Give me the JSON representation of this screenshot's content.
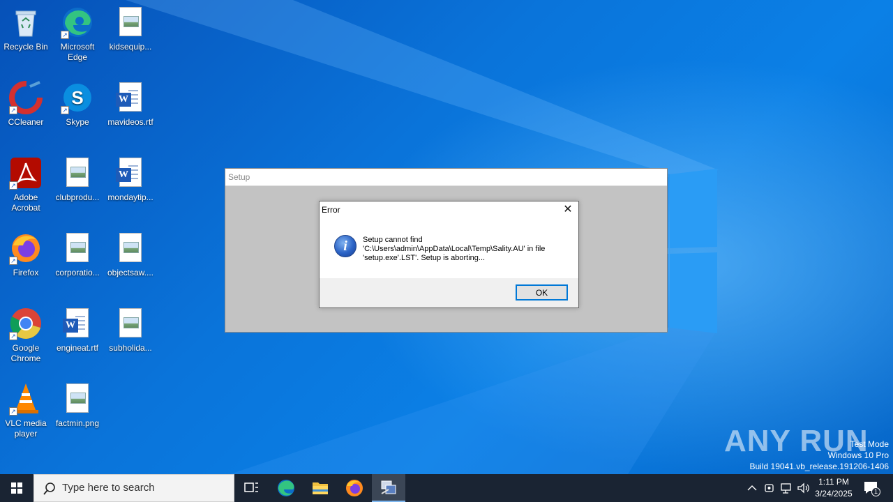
{
  "desktop": {
    "icons": [
      {
        "id": "recycle-bin",
        "label": "Recycle Bin"
      },
      {
        "id": "microsoft-edge",
        "label": "Microsoft Edge"
      },
      {
        "id": "kidsequip",
        "label": "kidsequip..."
      },
      {
        "id": "ccleaner",
        "label": "CCleaner"
      },
      {
        "id": "skype",
        "label": "Skype"
      },
      {
        "id": "mavideos",
        "label": "mavideos.rtf"
      },
      {
        "id": "adobe-acrobat",
        "label": "Adobe Acrobat"
      },
      {
        "id": "clubprodu",
        "label": "clubprodu..."
      },
      {
        "id": "mondaytip",
        "label": "mondaytip..."
      },
      {
        "id": "firefox",
        "label": "Firefox"
      },
      {
        "id": "corporatio",
        "label": "corporatio..."
      },
      {
        "id": "objectsaw",
        "label": "objectsaw...."
      },
      {
        "id": "google-chrome",
        "label": "Google Chrome"
      },
      {
        "id": "engineat",
        "label": "engineat.rtf"
      },
      {
        "id": "subholida",
        "label": "subholida..."
      },
      {
        "id": "vlc",
        "label": "VLC media player"
      },
      {
        "id": "factmin",
        "label": "factmin.png"
      }
    ]
  },
  "setup_window": {
    "title": "Setup"
  },
  "error_dialog": {
    "title": "Error",
    "close_glyph": "✕",
    "message_lines": [
      "Setup cannot find",
      "'C:\\Users\\admin\\AppData\\Local\\Temp\\Sality.AU' in file",
      "'setup.exe'.LST'.  Setup is aborting..."
    ],
    "ok_label": "OK"
  },
  "watermark": {
    "brand": "ANY RUN",
    "mode": "Test Mode",
    "edition": "Windows 10 Pro",
    "build": "Build 19041.vb_release.191206-1406"
  },
  "taskbar": {
    "search_placeholder": "Type here to search",
    "time": "1:11 PM",
    "date": "3/24/2025",
    "notification_count": "1"
  }
}
